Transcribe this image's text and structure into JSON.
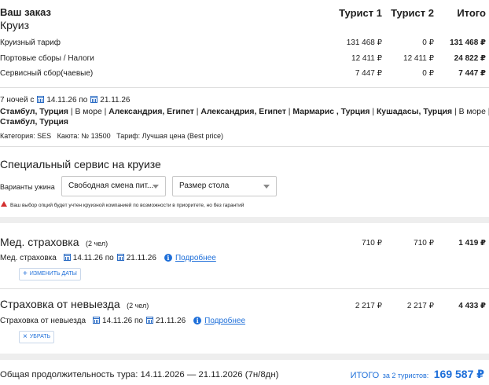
{
  "order": {
    "title": "Ваш заказ",
    "subtitle": "Круиз",
    "columns": [
      "Турист 1",
      "Турист 2",
      "Итого"
    ],
    "rows": [
      {
        "label": "Круизный тариф",
        "t1": "131 468 ₽",
        "t2": "0 ₽",
        "total": "131 468 ₽"
      },
      {
        "label": "Портовые сборы / Налоги",
        "t1": "12 411 ₽",
        "t2": "12 411 ₽",
        "total": "24 822 ₽"
      },
      {
        "label": "Сервисный сбор(чаевые)",
        "t1": "7 447 ₽",
        "t2": "0 ₽",
        "total": "7 447 ₽"
      }
    ]
  },
  "cruise": {
    "nights_prefix": "7 ночей с",
    "date_from": "14.11.26",
    "by": "по",
    "date_to": "21.11.26",
    "route_line1": [
      {
        "text": "Стамбул, Турция",
        "bold": true
      },
      {
        "text": " | В море | ",
        "bold": false
      },
      {
        "text": "Александрия, Египет",
        "bold": true
      },
      {
        "text": " | ",
        "bold": false
      },
      {
        "text": "Александрия, Египет",
        "bold": true
      },
      {
        "text": " | ",
        "bold": false
      },
      {
        "text": "Мармарис , Турция",
        "bold": true
      },
      {
        "text": " | ",
        "bold": false
      },
      {
        "text": "Кушадасы, Турция",
        "bold": true
      },
      {
        "text": " | В море |",
        "bold": false
      }
    ],
    "route_line2": "Стамбул, Турция",
    "details": "Категория: SES   Каюта: № 13500   Тариф: Лучшая цена (Best price)"
  },
  "service": {
    "title": "Специальный сервис на круизе",
    "dinner_label": "Варианты ужина",
    "dinner_value": "Свободная смена пит...",
    "table_value": "Размер стола",
    "warning": "Ваш выбор опций будет учтен круизной компанией по возможности в приоритете, но без гарантий"
  },
  "medical": {
    "title": "Мед. страховка",
    "persons": "(2 чел)",
    "t1": "710 ₽",
    "t2": "710 ₽",
    "total": "1 419 ₽",
    "line_label": "Мед. страховка",
    "date_from": "14.11.26",
    "by": "по",
    "date_to": "21.11.26",
    "more": "Подробнее",
    "change_dates": "ИЗМЕНИТЬ ДАТЫ"
  },
  "cancel": {
    "title": "Страховка от невыезда",
    "persons": "(2 чел)",
    "t1": "2 217 ₽",
    "t2": "2 217 ₽",
    "total": "4 433 ₽",
    "line_label": "Страховка от невыезда",
    "date_from": "14.11.26",
    "by": "по",
    "date_to": "21.11.26",
    "more": "Подробнее",
    "remove": "УБРАТЬ"
  },
  "footer": {
    "duration": "Общая продолжительность тура: 14.11.2026 — 21.11.2026 (7н/8дн)",
    "total_label": "ИТОГО",
    "total_for": "за 2 туристов:",
    "total_value": "169 587 ₽"
  },
  "colors": {
    "accent": "#1e6fd9",
    "warning": "#d32f2f"
  }
}
